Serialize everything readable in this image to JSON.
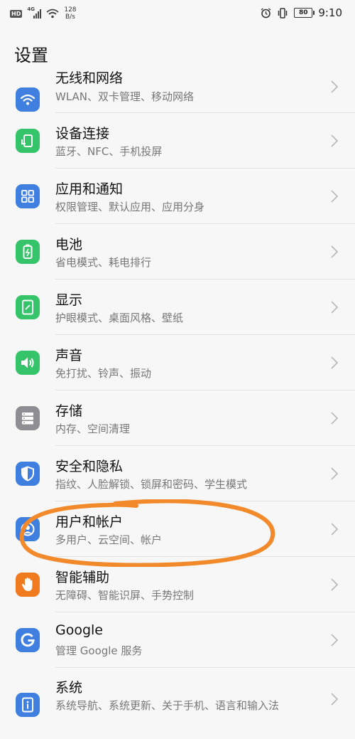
{
  "status_bar": {
    "hd": "HD",
    "network": "4G",
    "speed_value": "128",
    "speed_unit": "B/s",
    "battery": "80",
    "time": "9:10"
  },
  "page": {
    "title": "设置"
  },
  "settings": [
    {
      "title": "无线和网络",
      "subtitle": "WLAN、双卡管理、移动网络",
      "icon": "wifi-icon",
      "color": "#3f7fe0"
    },
    {
      "title": "设备连接",
      "subtitle": "蓝牙、NFC、手机投屏",
      "icon": "device-connect-icon",
      "color": "#35c46a"
    },
    {
      "title": "应用和通知",
      "subtitle": "权限管理、默认应用、应用分身",
      "icon": "apps-grid-icon",
      "color": "#3f7fe0"
    },
    {
      "title": "电池",
      "subtitle": "省电模式、耗电排行",
      "icon": "battery-icon",
      "color": "#35c46a"
    },
    {
      "title": "显示",
      "subtitle": "护眼模式、桌面风格、壁纸",
      "icon": "display-icon",
      "color": "#35c46a"
    },
    {
      "title": "声音",
      "subtitle": "免打扰、铃声、振动",
      "icon": "speaker-icon",
      "color": "#35c46a"
    },
    {
      "title": "存储",
      "subtitle": "内存、空间清理",
      "icon": "storage-icon",
      "color": "#8e8e93"
    },
    {
      "title": "安全和隐私",
      "subtitle": "指纹、人脸解锁、锁屏和密码、学生模式",
      "icon": "shield-icon",
      "color": "#3f7fe0"
    },
    {
      "title": "用户和帐户",
      "subtitle": "多用户、云空间、帐户",
      "icon": "user-account-icon",
      "color": "#3f7fe0"
    },
    {
      "title": "智能辅助",
      "subtitle": "无障碍、智能识屏、手势控制",
      "icon": "hand-icon",
      "color": "#f07a1e"
    },
    {
      "title": "Google",
      "subtitle": "管理 Google 服务",
      "icon": "google-icon",
      "color": "#3f7fe0"
    },
    {
      "title": "系统",
      "subtitle": "系统导航、系统更新、关于手机、语言和输入法",
      "icon": "system-info-icon",
      "color": "#3f7fe0"
    }
  ],
  "annotation_color": "#f28a2c"
}
